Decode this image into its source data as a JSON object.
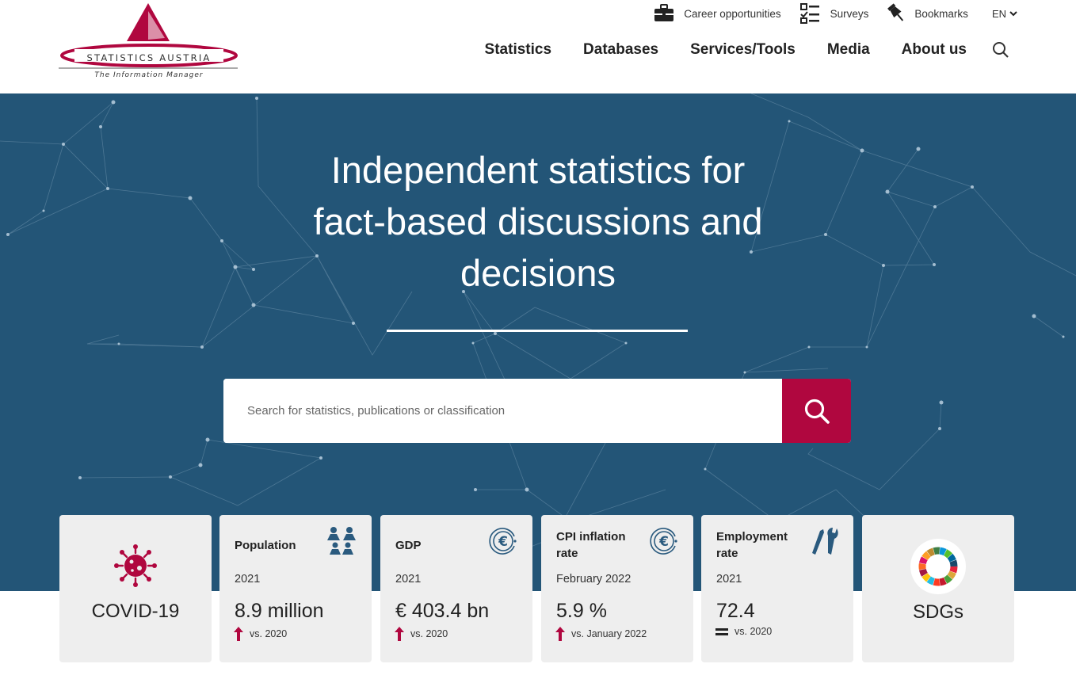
{
  "logo": {
    "name": "STATISTICS AUSTRIA",
    "tagline": "The Information Manager",
    "brand_color": "#b0073f"
  },
  "utility_nav": {
    "career": "Career opportunities",
    "surveys": "Surveys",
    "bookmarks": "Bookmarks",
    "language": "EN"
  },
  "main_nav": {
    "items": [
      "Statistics",
      "Databases",
      "Services/Tools",
      "Media",
      "About us"
    ]
  },
  "hero": {
    "title_line1": "Independent statistics for",
    "title_line2": "fact-based discussions and",
    "title_line3": "decisions",
    "background_color": "#235577"
  },
  "search": {
    "placeholder": "Search for statistics, publications or classification",
    "button_color": "#b0073f"
  },
  "cards": {
    "covid": {
      "label": "COVID-19",
      "icon": "virus-icon"
    },
    "population": {
      "title": "Population",
      "period": "2021",
      "value": "8.9 million",
      "compare": "vs. 2020",
      "trend": "up",
      "icon": "people-icon"
    },
    "gdp": {
      "title": "GDP",
      "period": "2021",
      "value": "€ 403.4 bn",
      "compare": "vs. 2020",
      "trend": "up",
      "icon": "euro-icon"
    },
    "cpi": {
      "title": "CPI inflation rate",
      "period": "February 2022",
      "value": "5.9 %",
      "compare": "vs. January 2022",
      "trend": "up",
      "icon": "euro-icon"
    },
    "employment": {
      "title": "Employment rate",
      "period": "2021",
      "value": "72.4",
      "compare": "vs. 2020",
      "trend": "equal",
      "icon": "tools-icon"
    },
    "sdgs": {
      "label": "SDGs",
      "icon": "sdg-wheel-icon"
    }
  }
}
